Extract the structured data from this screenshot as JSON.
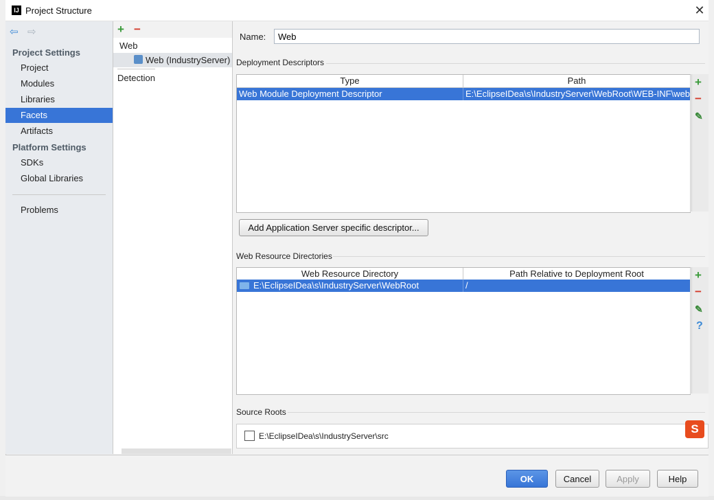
{
  "window": {
    "title": "Project Structure",
    "app_icon_text": "IJ",
    "close_glyph": "✕"
  },
  "sidebar": {
    "back_glyph": "⇦",
    "forward_glyph": "⇨",
    "project_settings_header": "Project Settings",
    "project_items": [
      "Project",
      "Modules",
      "Libraries",
      "Facets",
      "Artifacts"
    ],
    "selected": "Facets",
    "platform_settings_header": "Platform Settings",
    "platform_items": [
      "SDKs",
      "Global Libraries"
    ],
    "problems": "Problems"
  },
  "tree": {
    "add_glyph": "+",
    "remove_glyph": "−",
    "web_node": "Web",
    "web_child": "Web (IndustryServer)",
    "detection": "Detection"
  },
  "form": {
    "name_label": "Name:",
    "name_value": "Web"
  },
  "deployment_descriptors": {
    "title": "Deployment Descriptors",
    "columns": [
      "Type",
      "Path"
    ],
    "rows": [
      {
        "type": "Web Module Deployment Descriptor",
        "path": "E:\\EclipseIDea\\s\\IndustryServer\\WebRoot\\WEB-INF\\web.xml"
      }
    ],
    "add_button": "Add Application Server specific descriptor..."
  },
  "web_resource_directories": {
    "title": "Web Resource Directories",
    "columns": [
      "Web Resource Directory",
      "Path Relative to Deployment Root"
    ],
    "rows": [
      {
        "directory": "E:\\EclipseIDea\\s\\IndustryServer\\WebRoot",
        "relative": "/"
      }
    ]
  },
  "source_roots": {
    "title": "Source Roots",
    "items": [
      {
        "path": "E:\\EclipseIDea\\s\\IndustryServer\\src",
        "checked": false
      }
    ]
  },
  "toolbar_glyphs": {
    "add": "+",
    "remove": "−",
    "edit": "✎",
    "help": "?"
  },
  "buttons": {
    "ok": "OK",
    "cancel": "Cancel",
    "apply": "Apply",
    "help": "Help"
  },
  "ime_icon_text": "S",
  "colors": {
    "selection": "#3875d7",
    "add_green": "#3a9a3a",
    "remove_red": "#d43a2a"
  }
}
